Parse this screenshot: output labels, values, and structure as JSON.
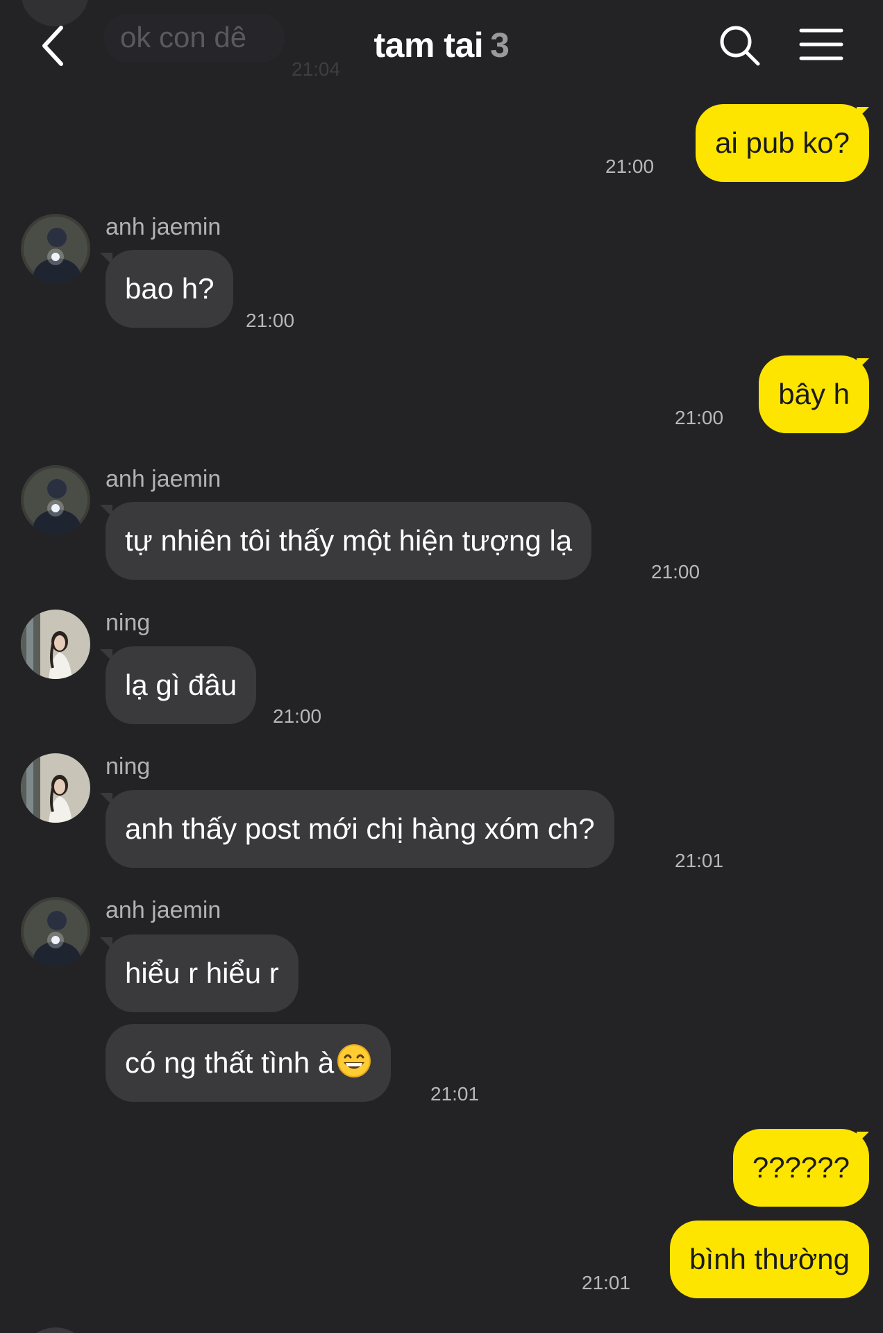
{
  "header": {
    "title": "tam tai",
    "member_count": "3",
    "previous_message": {
      "text": "ok con dê",
      "time": "21:04"
    }
  },
  "messages": {
    "m1": {
      "text": "ai pub ko?",
      "time": "21:00"
    },
    "m2": {
      "sender": "anh jaemin",
      "text": "bao h?",
      "time": "21:00"
    },
    "m3": {
      "text": "bây h",
      "time": "21:00"
    },
    "m4": {
      "sender": "anh jaemin",
      "text": "tự nhiên tôi thấy một hiện tượng lạ",
      "time": "21:00"
    },
    "m5": {
      "sender": "ning",
      "text": "lạ gì đâu",
      "time": "21:00"
    },
    "m6": {
      "sender": "ning",
      "text": "anh thấy post mới chị hàng xóm ch?",
      "time": "21:01"
    },
    "m7": {
      "sender": "anh jaemin",
      "text": "hiểu r hiểu r"
    },
    "m8": {
      "text": "có ng thất tình à",
      "emoji": "grinning-face-smiling-eyes-icon",
      "time": "21:01"
    },
    "m9": {
      "text": "??????"
    },
    "m10": {
      "text": "bình thường",
      "time": "21:01"
    }
  },
  "colors": {
    "background": "#232326",
    "incoming_bubble": "#3a3a3d",
    "outgoing_bubble": "#fee500",
    "outgoing_text": "#1b1b1b",
    "timestamp": "#b8b8bc"
  },
  "icons": {
    "back": "chevron-left-icon",
    "search": "search-icon",
    "menu": "hamburger-menu-icon"
  }
}
